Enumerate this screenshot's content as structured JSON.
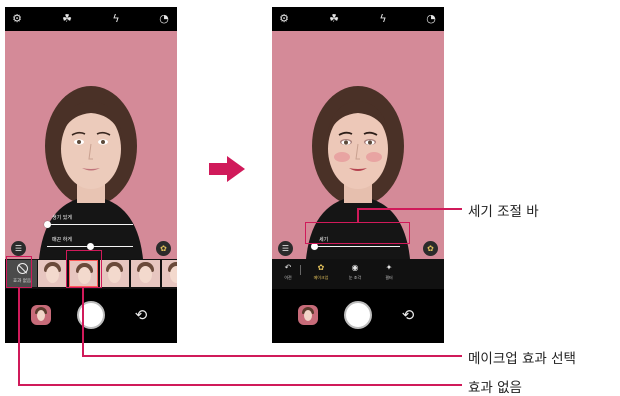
{
  "left_phone": {
    "slider1_label": "생기 있게",
    "slider1_value": 0.0,
    "slider2_label": "매끈 하게",
    "slider2_value": 0.5,
    "no_effect_label": "효과 없음",
    "selected_thumb_index": 1
  },
  "right_phone": {
    "strength_label": "세기",
    "strength_value": 0.0,
    "menu": [
      {
        "label": "이전",
        "icon": "undo-icon"
      },
      {
        "label": "메이크업",
        "icon": "makeup-icon",
        "active": true
      },
      {
        "label": "눈 조각",
        "icon": "eye-icon"
      },
      {
        "label": "필터",
        "icon": "filter-icon"
      }
    ]
  },
  "callouts": {
    "strength_bar": "세기 조절 바",
    "makeup_select": "메이크업 효과 선택",
    "no_effect": "효과 없음"
  },
  "colors": {
    "accent": "#d01a5a",
    "background": "#d48a98",
    "active_icon": "#e2c15c"
  }
}
